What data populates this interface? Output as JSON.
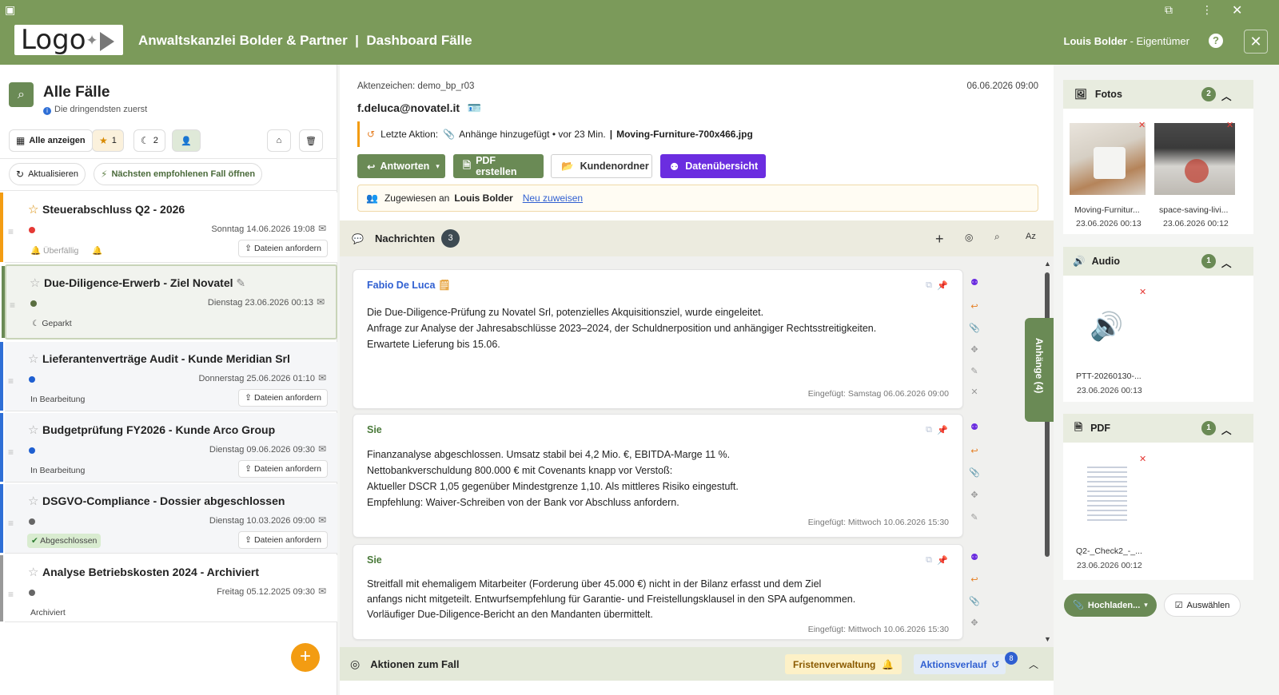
{
  "header": {
    "logo": "Logo",
    "title": "Anwaltskanzlei Bolder & Partner  |  Dashboard Fälle",
    "user": "Louis Bolder",
    "role": " - Eigentümer",
    "help": "?",
    "close": "✕"
  },
  "left": {
    "title": "Alle Fälle",
    "subtitle": "Die dringendsten zuerst",
    "filters": {
      "all": "Alle anzeigen",
      "starred": "1",
      "parked": "2"
    },
    "refresh": "Aktualisieren",
    "next_case": "Nächsten empfohlenen Fall öffnen",
    "cases": [
      {
        "title": "Steuerabschluss Q2 - 2026",
        "date": "Sonntag 14.06.2026 19:08",
        "status": "Überfällig",
        "request": "Dateien anfordern"
      },
      {
        "title": "Due-Diligence-Erwerb - Ziel Novatel",
        "date": "Dienstag 23.06.2026 00:13",
        "status": "Geparkt",
        "request": ""
      },
      {
        "title": "Lieferantenverträge Audit - Kunde Meridian Srl",
        "date": "Donnerstag 25.06.2026 01:10",
        "status": "In Bearbeitung",
        "request": "Dateien anfordern"
      },
      {
        "title": "Budgetprüfung FY2026 - Kunde Arco Group",
        "date": "Dienstag 09.06.2026 09:30",
        "status": "In Bearbeitung",
        "request": "Dateien anfordern"
      },
      {
        "title": "DSGVO-Compliance - Dossier abgeschlossen",
        "date": "Dienstag 10.03.2026 09:00",
        "status": "Abgeschlossen",
        "request": "Dateien anfordern"
      },
      {
        "title": "Analyse Betriebskosten 2024 - Archiviert",
        "date": "Freitag 05.12.2025 09:30",
        "status": "Archiviert",
        "request": ""
      }
    ]
  },
  "center": {
    "case_ref": "Aktenzeichen: demo_bp_r03",
    "datetime": "06.06.2026 09:00",
    "email": "f.deluca@novatel.it",
    "last_action_label": "Letzte Aktion:",
    "last_action": "Anhänge hinzugefügt • vor 23 Min.",
    "last_file": "Moving-Furniture-700x466.jpg",
    "buttons": {
      "reply": "Antworten",
      "pdf": "PDF erstellen",
      "folder": "Kundenordner",
      "data": "Datenübersicht"
    },
    "assigned_label": "Zugewiesen an",
    "assigned_to": "Louis Bolder",
    "reassign": "Neu zuweisen",
    "messages_title": "Nachrichten",
    "messages_count": "3",
    "sort": "Az",
    "attachments_tab": "Anhänge (4)",
    "messages": [
      {
        "author": "Fabio De Luca",
        "body": "Die Due-Diligence-Prüfung zu Novatel Srl, potenzielles Akquisitionsziel, wurde eingeleitet.\nAnfrage zur Analyse der Jahresabschlüsse 2023–2024, der Schuldnerposition und anhängiger Rechtsstreitigkeiten.\nErwartete Lieferung bis 15.06.",
        "inserted": "Eingefügt: Samstag 06.06.2026 09:00"
      },
      {
        "author": "Sie",
        "body": "Finanzanalyse abgeschlossen. Umsatz stabil bei 4,2 Mio. €, EBITDA-Marge 11 %.\nNettobankverschuldung 800.000 € mit Covenants knapp vor Verstoß:\nAktueller DSCR 1,05 gegenüber Mindestgrenze 1,10. Als mittleres Risiko eingestuft.\nEmpfehlung: Waiver-Schreiben von der Bank vor Abschluss anfordern.",
        "inserted": "Eingefügt: Mittwoch 10.06.2026 15:30"
      },
      {
        "author": "Sie",
        "body": "Streitfall mit ehemaligem Mitarbeiter (Forderung über 45.000 €) nicht in der Bilanz erfasst und dem Ziel\nanfangs nicht mitgeteilt. Entwurfsempfehlung für Garantie- und Freistellungsklausel in den SPA aufgenommen.\nVorläufiger Due-Diligence-Bericht an den Mandanten übermittelt.",
        "inserted": "Eingefügt: Mittwoch 10.06.2026 15:30"
      }
    ],
    "actions_title": "Aktionen zum Fall",
    "deadlines": "Fristenverwaltung",
    "history": "Aktionsverlauf",
    "history_count": "8"
  },
  "right": {
    "photos": {
      "title": "Fotos",
      "count": "2",
      "items": [
        {
          "name": "Moving-Furnitur...",
          "date": "23.06.2026 00:13"
        },
        {
          "name": "space-saving-livi...",
          "date": "23.06.2026 00:12"
        }
      ]
    },
    "audio": {
      "title": "Audio",
      "count": "1",
      "items": [
        {
          "name": "PTT-20260130-...",
          "date": "23.06.2026 00:13"
        }
      ]
    },
    "pdf": {
      "title": "PDF",
      "count": "1",
      "items": [
        {
          "name": "Q2-_Check2_-_...",
          "date": "23.06.2026 00:12"
        }
      ]
    },
    "upload": "Hochladen...",
    "select": "Auswählen"
  },
  "colors": {
    "header": "#7b9a5a",
    "accent": "#6a8a55",
    "purple": "#6b2de0",
    "orange": "#f39c12"
  }
}
